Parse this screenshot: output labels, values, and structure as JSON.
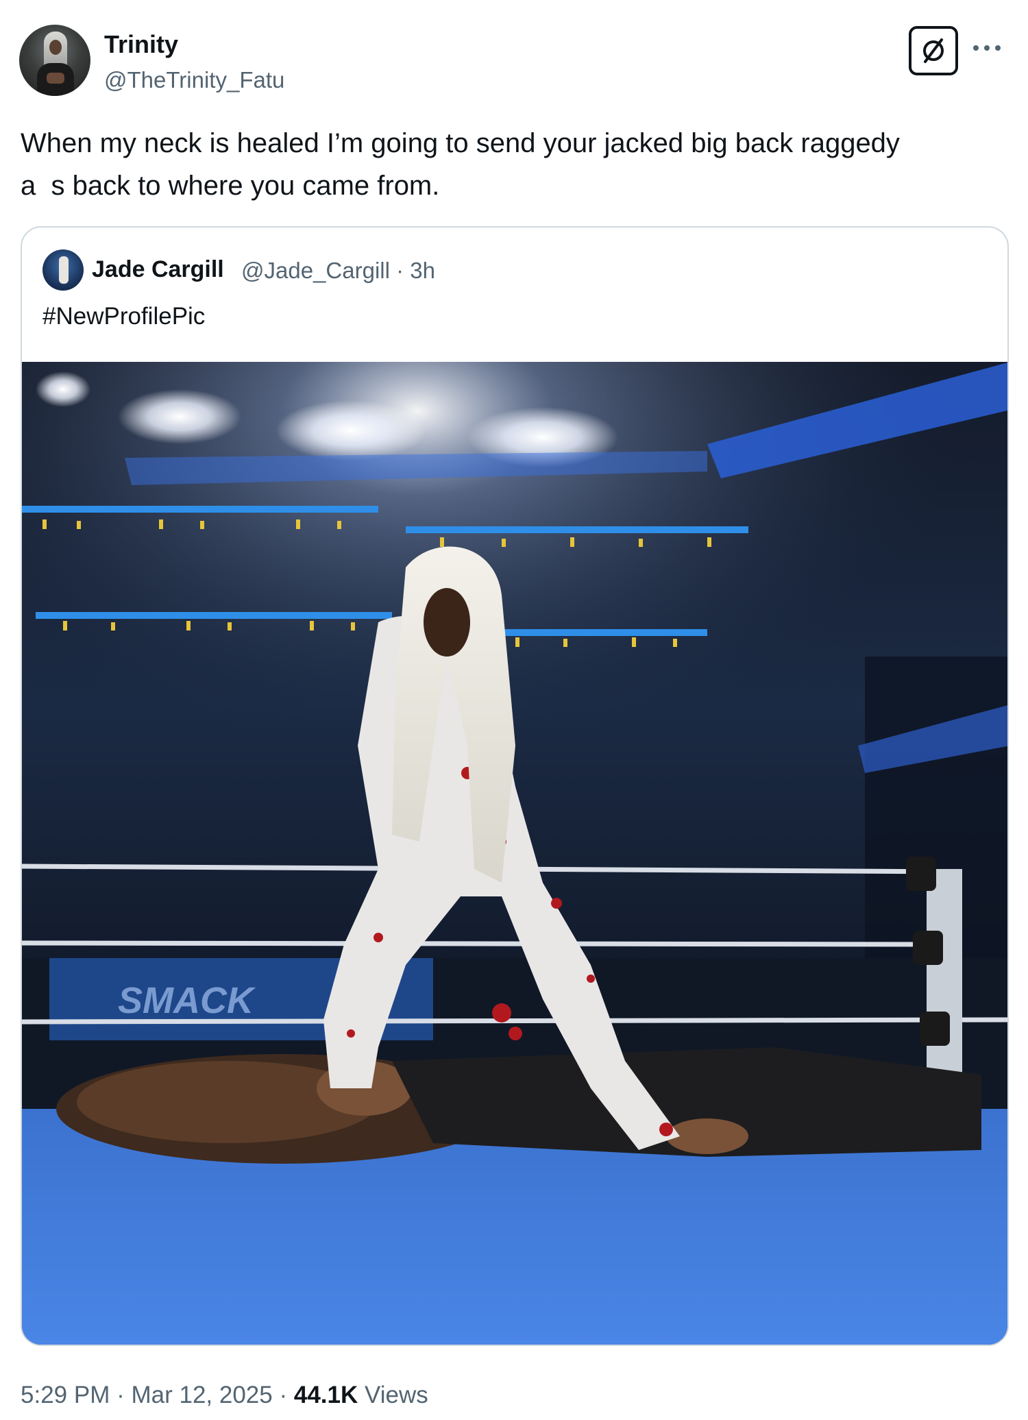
{
  "author": {
    "name": "Trinity",
    "handle": "@TheTrinity_Fatu"
  },
  "tweet": {
    "line1": "When my neck is healed I’m going to send your jacked big back raggedy",
    "line2": "a  s back to where you came from."
  },
  "quoted": {
    "name": "Jade Cargill",
    "handle": "@Jade_Cargill",
    "separator": "·",
    "age": "3h",
    "text": "#NewProfilePic",
    "media_signage": "SMACK"
  },
  "footer": {
    "time": "5:29 PM",
    "separator": "·",
    "date": "Mar 12, 2025",
    "views_count": "44.1K",
    "views_label": "Views"
  },
  "icons": {
    "grok": "grok-slash-circle-icon",
    "more": "more-horizontal-icon"
  },
  "colors": {
    "text_primary": "#0f1419",
    "text_secondary": "#536471",
    "border": "#cfd9de",
    "ring_mat": "#3f78d6"
  }
}
